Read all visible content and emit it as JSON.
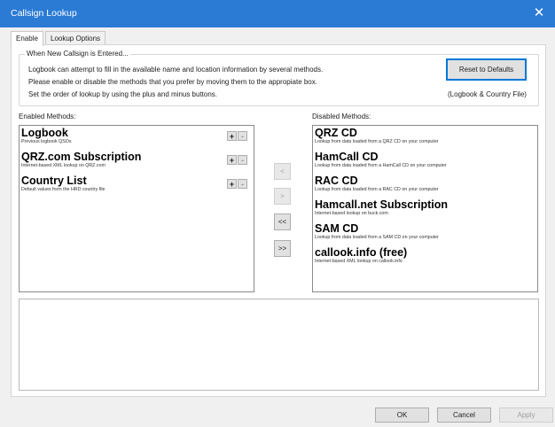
{
  "window": {
    "title": "Callsign Lookup",
    "close_glyph": "✕"
  },
  "tabs": [
    {
      "label": "Enable"
    },
    {
      "label": "Lookup Options"
    }
  ],
  "group": {
    "legend": "When New Callsign is Entered...",
    "lines": [
      "Logbook can attempt to fill in the available name and location information by several methods.",
      "Please enable or disable the methods that you prefer by moving them to the appropiate box.",
      "Set the order of lookup by using the plus and minus buttons."
    ],
    "reset_label": "Reset to Defaults",
    "reset_note": "(Logbook & Country File)"
  },
  "enabled": {
    "label": "Enabled Methods:",
    "items": [
      {
        "name": "Logbook",
        "desc": "Previous logbook QSOs"
      },
      {
        "name": "QRZ.com Subscription",
        "desc": "Internet-based XML lookup on QRZ.com"
      },
      {
        "name": "Country List",
        "desc": "Default values from the HRD country file"
      }
    ],
    "plus": "+",
    "minus": "-"
  },
  "disabled": {
    "label": "Disabled Methods:",
    "items": [
      {
        "name": "QRZ CD",
        "desc": "Lookup from data loaded from a QRZ CD on your computer"
      },
      {
        "name": "HamCall CD",
        "desc": "Lookup from data loaded from a HamCall CD on your computer"
      },
      {
        "name": "RAC CD",
        "desc": "Lookup from data loaded from a RAC CD on your computer"
      },
      {
        "name": "Hamcall.net Subscription",
        "desc": "Internet-based  lookup on buck.com"
      },
      {
        "name": "SAM CD",
        "desc": "Lookup from data loaded from a SAM CD on your computer"
      },
      {
        "name": "callook.info (free)",
        "desc": "Internet-based XML lookup on callook.info"
      }
    ]
  },
  "move": {
    "left": "<",
    "right": ">",
    "all_left": "<<",
    "all_right": ">>"
  },
  "footer": {
    "ok": "OK",
    "cancel": "Cancel",
    "apply": "Apply"
  }
}
